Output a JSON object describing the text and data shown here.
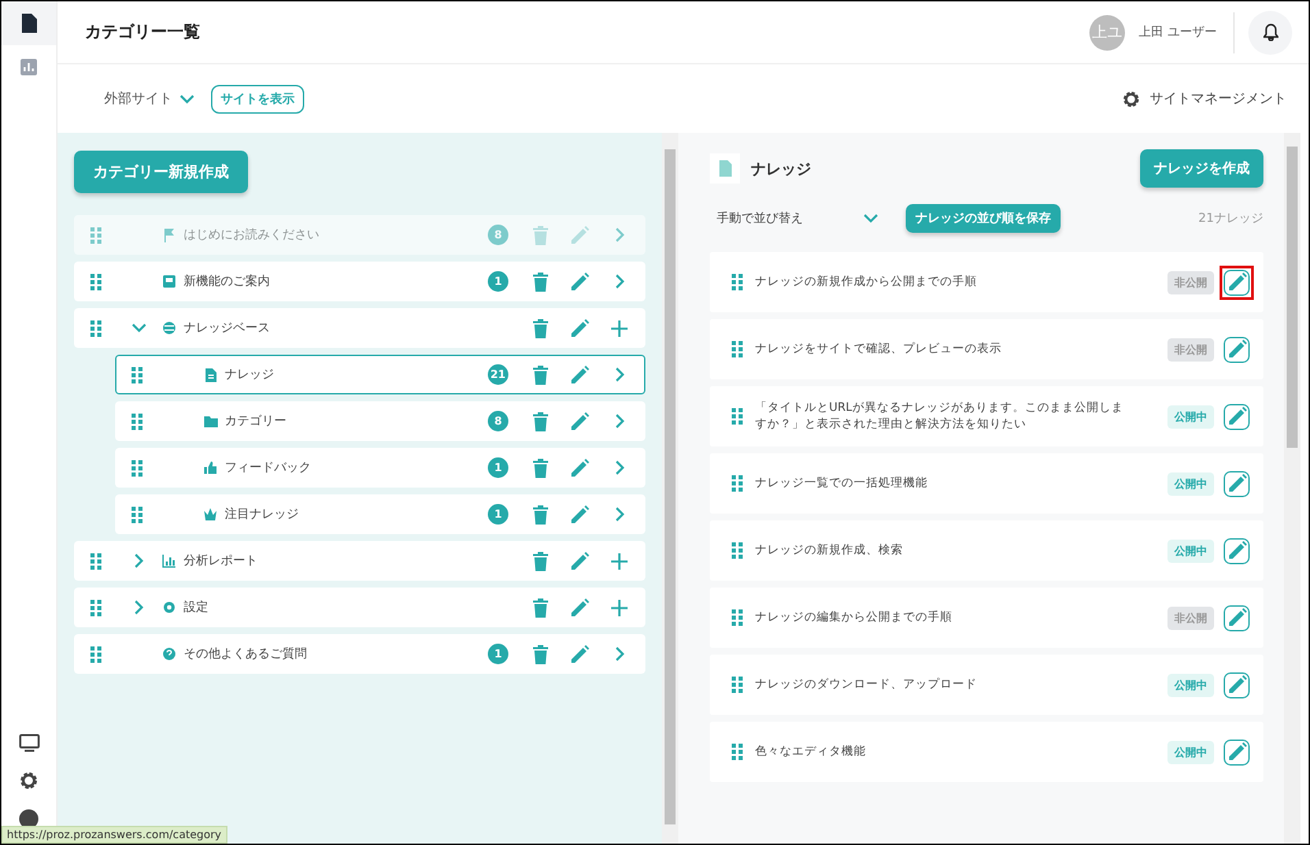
{
  "sidebar": {
    "items": [
      {
        "kind": "document",
        "selected": true
      },
      {
        "kind": "chart",
        "selected": false
      }
    ],
    "bottom_items": [
      {
        "kind": "monitor"
      },
      {
        "kind": "settings"
      },
      {
        "kind": "help"
      }
    ]
  },
  "header": {
    "title": "カテゴリー一覧",
    "user": {
      "initials": "上ユ",
      "name": "上田 ユーザー"
    }
  },
  "toolbar": {
    "site_selector": "外部サイト",
    "view_site_button": "サイトを表示",
    "site_management": "サイトマネージメント"
  },
  "categories": {
    "create_button": "カテゴリー新規作成",
    "items": [
      {
        "label": "はじめにお読みください",
        "kind": "flag",
        "count": "8",
        "can_add": false,
        "disabled": true,
        "selected": false
      },
      {
        "label": "新機能のご案内",
        "kind": "news",
        "count": "1",
        "can_add": false,
        "disabled": false,
        "selected": false
      },
      {
        "label": "ナレッジベース",
        "kind": "globe",
        "can_add": true,
        "expanded": true,
        "disabled": false,
        "selected": false,
        "children": [
          {
            "label": "ナレッジ",
            "kind": "document",
            "count": "21",
            "can_add": false,
            "disabled": false,
            "selected": true
          },
          {
            "label": "カテゴリー",
            "kind": "folder",
            "count": "8",
            "can_add": false,
            "disabled": false,
            "selected": false
          },
          {
            "label": "フィードバック",
            "kind": "thumb",
            "count": "1",
            "can_add": false,
            "disabled": false,
            "selected": false
          },
          {
            "label": "注目ナレッジ",
            "kind": "crown",
            "count": "1",
            "can_add": false,
            "disabled": false,
            "selected": false
          }
        ]
      },
      {
        "label": "分析レポート",
        "kind": "chart",
        "can_add": true,
        "expanded": false,
        "disabled": false,
        "selected": false
      },
      {
        "label": "設定",
        "kind": "gear",
        "can_add": true,
        "expanded": false,
        "disabled": false,
        "selected": false
      },
      {
        "label": "その他よくあるご質問",
        "kind": "question",
        "count": "1",
        "can_add": false,
        "disabled": false,
        "selected": false
      }
    ]
  },
  "knowledge": {
    "title": "ナレッジ",
    "create_button": "ナレッジを作成",
    "sort": "手動で並び替え",
    "save_order_button": "ナレッジの並び順を保存",
    "total": "21ナレッジ",
    "items": [
      {
        "title": "ナレッジの新規作成から公開までの手順",
        "status": "非公開",
        "public": false,
        "highlighted": true
      },
      {
        "title": "ナレッジをサイトで確認、プレビューの表示",
        "status": "非公開",
        "public": false,
        "highlighted": false
      },
      {
        "title": "「タイトルとURLが異なるナレッジがあります。このまま公開しますか？」と表示された理由と解決方法を知りたい",
        "status": "公開中",
        "public": true,
        "highlighted": false
      },
      {
        "title": "ナレッジ一覧での一括処理機能",
        "status": "公開中",
        "public": true,
        "highlighted": false
      },
      {
        "title": "ナレッジの新規作成、検索",
        "status": "公開中",
        "public": true,
        "highlighted": false
      },
      {
        "title": "ナレッジの編集から公開までの手順",
        "status": "非公開",
        "public": false,
        "highlighted": false
      },
      {
        "title": "ナレッジのダウンロード、アップロード",
        "status": "公開中",
        "public": true,
        "highlighted": false
      },
      {
        "title": "色々なエディタ機能",
        "status": "公開中",
        "public": true,
        "highlighted": false
      }
    ]
  },
  "status_bar": {
    "url": "https://proz.prozanswers.com/category"
  }
}
